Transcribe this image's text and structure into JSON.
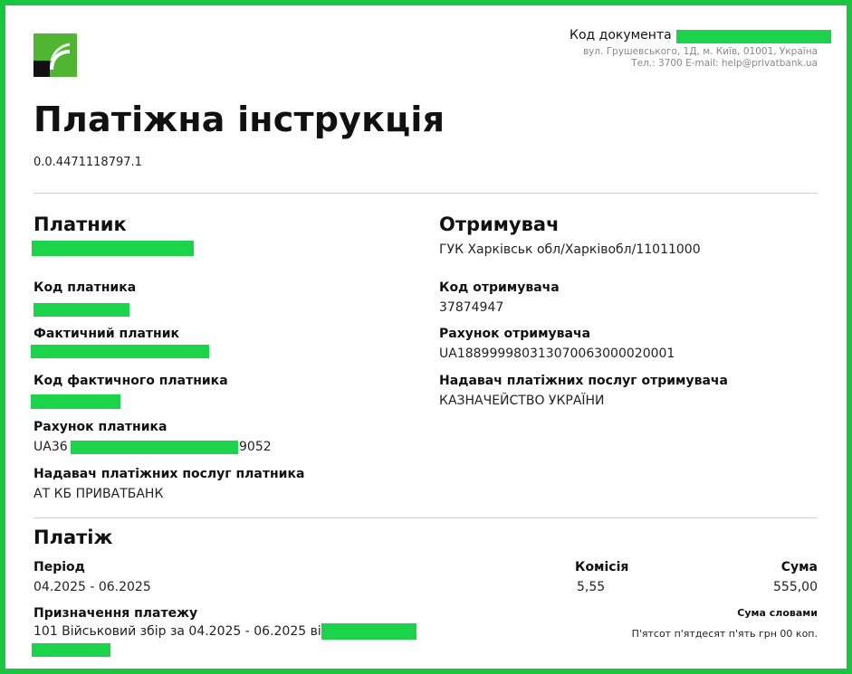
{
  "header": {
    "doc_code_label": "Код документа",
    "address_line1": "вул. Грушевського, 1Д, м. Київ, 01001, Україна",
    "address_line2": "Тел.: 3700  E-mail: help@privatbank.ua",
    "brand_color": "#4fb532",
    "redaction_color": "#1bd44a"
  },
  "title": "Платіжна інструкція",
  "doc_id": "0.0.4471118797.1",
  "payer": {
    "heading": "Платник",
    "code_label": "Код платника",
    "actual_payer_label": "Фактичний платник",
    "actual_payer_code_label": "Код фактичного платника",
    "account_label": "Рахунок платника",
    "account_prefix": "UA36",
    "account_suffix": "9052",
    "psp_label": "Надавач платіжних послуг платника",
    "psp_value": "АТ КБ ПРИВАТБАНК"
  },
  "recipient": {
    "heading": "Отримувач",
    "name": "ГУК Харківськ обл/Харківобл/11011000",
    "code_label": "Код отримувача",
    "code_value": "37874947",
    "account_label": "Рахунок отримувача",
    "account_value": "UA188999980313070063000020001",
    "psp_label": "Надавач платіжних послуг отримувача",
    "psp_value": "КАЗНАЧЕЙСТВО УКРАЇНИ"
  },
  "payment": {
    "heading": "Платіж",
    "period_label": "Період",
    "period_value": "04.2025 - 06.2025",
    "commission_label": "Комісія",
    "commission_value": "5,55",
    "sum_label": "Сума",
    "sum_value": "555,00",
    "purpose_label": "Призначення платежу",
    "purpose_value": "101 Військовий збір за 04.2025 - 06.2025 від",
    "sum_words_label": "Сума словами",
    "sum_words_value": "П'ятсот п'ятдесят п'ять грн 00 коп."
  }
}
